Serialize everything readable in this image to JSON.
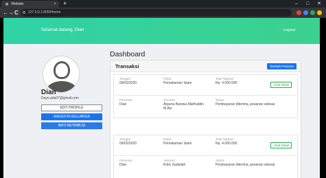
{
  "browser": {
    "tab_title": "Website",
    "tab_close": "×",
    "new_tab": "+",
    "win_min": "–",
    "win_max": "□",
    "win_close": "✕",
    "back": "←",
    "forward": "→",
    "reload": "C",
    "url": "127.0.0.1:8000/home",
    "ext_colors": [
      "#e94235",
      "#4285f4",
      "#34a853",
      "#fbbc05"
    ]
  },
  "header": {
    "welcome": "Selamat datang, Dian",
    "logout": "Logout",
    "accent_start": "#2fd3a6",
    "accent_end": "#3bd18e"
  },
  "profile": {
    "name": "Dian",
    "email": "Dayu.adu07@gmail.com",
    "edit_label": "EDIT PROFILE",
    "anggota_label": "ANGGOTA KELUARGA",
    "info_label": "INFO RETRIBUSI"
  },
  "main": {
    "title": "Dashboard",
    "card_title": "Transaksi",
    "new_order_label": "Tambah Pesanan",
    "detail_label": "Lihat Detail",
    "labels": {
      "date": "Tanggal",
      "package": "Paket",
      "total": "Total Tagihan",
      "customer": "Pemesan",
      "recipient": "Jenazah",
      "status": "Status"
    },
    "transactions": [
      {
        "date": "09/02/2020",
        "package": "Pemakaman Islam",
        "total": "Rp. 4.000.000",
        "customer": "Dian",
        "recipient": "Aliyana Baniwa Mahfuddin M.Aw",
        "status": "Pembayaran diterima, pesanan selesai"
      },
      {
        "date": "09/02/2020",
        "package": "Pemakaman Islam",
        "total": "Rp. 4.000.000",
        "customer": "Dian",
        "recipient": "Koko Saduliah",
        "status": "Pembayaran diterima, pesanan selesai"
      }
    ]
  }
}
